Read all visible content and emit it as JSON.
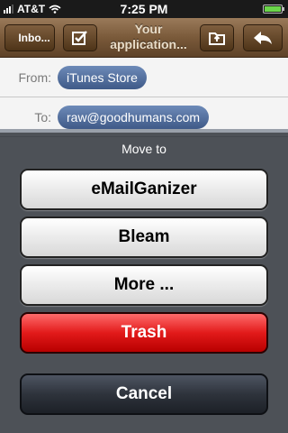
{
  "status_bar": {
    "carrier": "AT&T",
    "time": "7:25 PM"
  },
  "nav": {
    "back_label": "Inbo...",
    "title_line1": "Your",
    "title_line2": "application..."
  },
  "header": {
    "from_label": "From:",
    "from_value": "iTunes Store",
    "to_label": "To:",
    "to_value": "raw@goodhumans.com"
  },
  "action_sheet": {
    "title": "Move to",
    "buttons": [
      "eMailGanizer",
      "Bleam",
      "More ...",
      "Trash"
    ],
    "cancel": "Cancel"
  }
}
